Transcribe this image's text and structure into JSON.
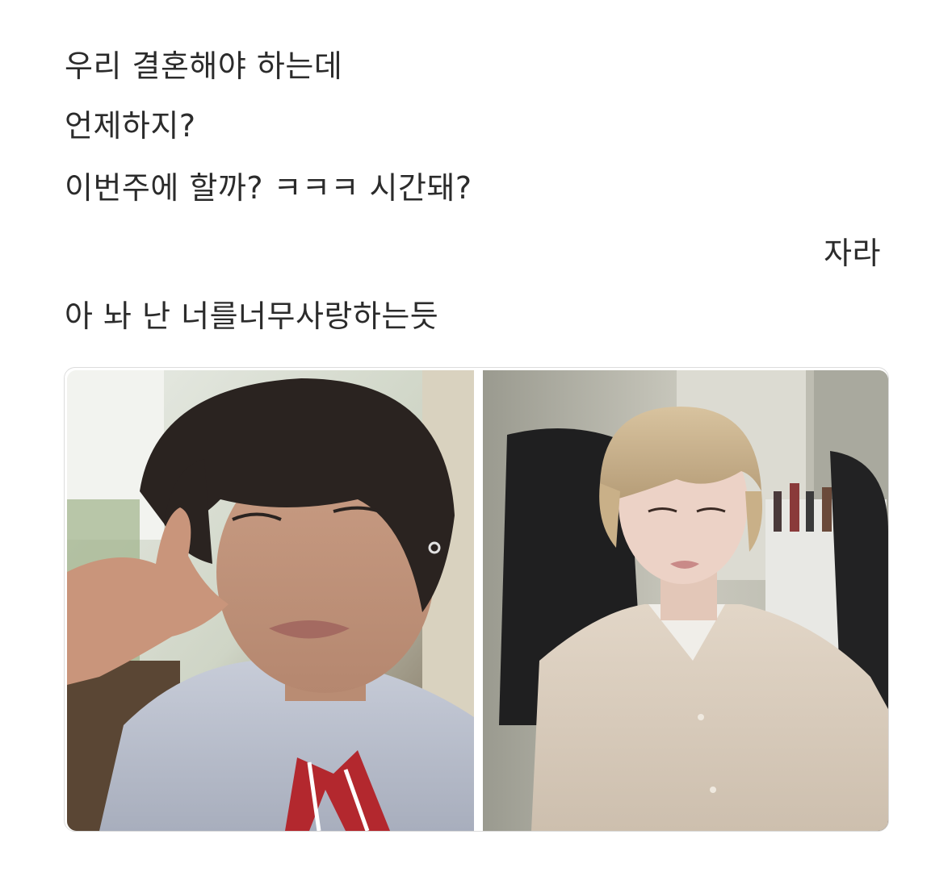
{
  "message": {
    "lines": [
      "우리 결혼해야 하는데",
      "언제하지?",
      "이번주에 할까? ㅋㅋㅋ 시간돼?",
      "자라",
      "아 놔 난 너를너무사랑하는듯"
    ]
  },
  "photos": [
    {
      "name": "left-photo",
      "subject": "dark-haired person in school uniform with red striped tie"
    },
    {
      "name": "right-photo",
      "subject": "blond-haired person in beige shirt at desk"
    }
  ],
  "colors": {
    "text": "#2b2b2b",
    "background": "#ffffff",
    "frame_border": "#dcdcdc"
  }
}
